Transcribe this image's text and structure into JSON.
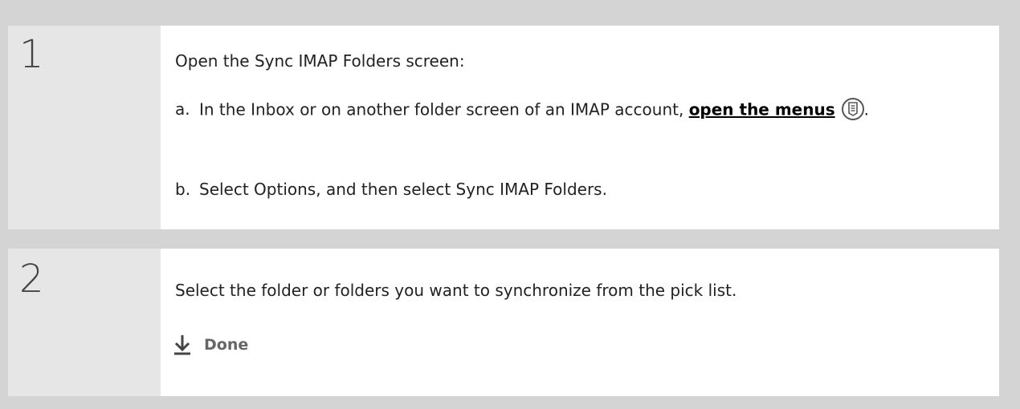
{
  "steps": [
    {
      "number": "1",
      "intro": "Open the Sync IMAP Folders screen:",
      "sub_a": {
        "letter": "a.",
        "text_before": "In the Inbox or on another folder screen of an IMAP account, ",
        "link": "open the menus",
        "text_after": ".",
        "icon": "menu-icon"
      },
      "sub_b": {
        "letter": "b.",
        "text": "Select Options, and then select Sync IMAP Folders."
      }
    },
    {
      "number": "2",
      "text": "Select the folder or folders you want to synchronize from the pick list.",
      "done_label": "Done",
      "done_icon": "down-arrow-icon"
    }
  ],
  "colors": {
    "background": "#d4d4d4",
    "number_column": "#e6e6e6",
    "content": "#ffffff"
  }
}
